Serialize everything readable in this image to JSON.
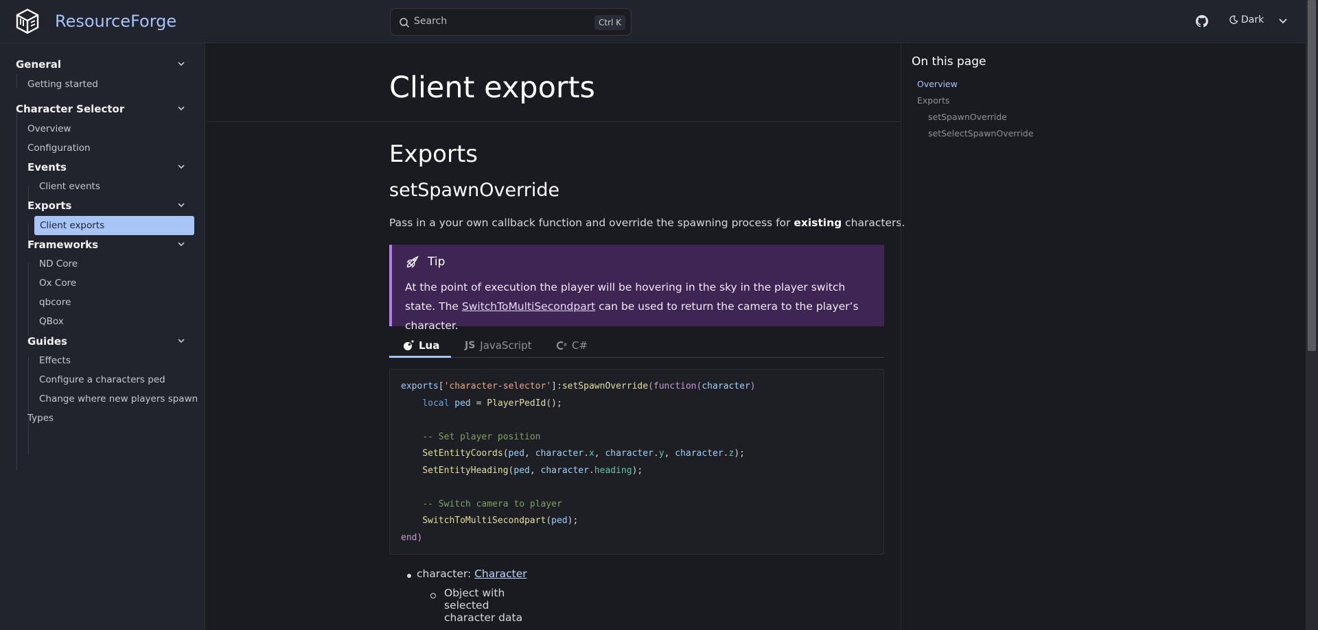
{
  "header": {
    "brand": "ResourceForge",
    "search_placeholder": "Search",
    "search_shortcut": "Ctrl K",
    "theme_label": "Dark"
  },
  "sidebar": {
    "general": {
      "title": "General",
      "items": [
        "Getting started"
      ]
    },
    "character_selector": {
      "title": "Character Selector",
      "items": [
        "Overview",
        "Configuration"
      ],
      "events": {
        "title": "Events",
        "items": [
          "Client events"
        ]
      },
      "exports": {
        "title": "Exports",
        "items": [
          "Client exports"
        ]
      },
      "frameworks": {
        "title": "Frameworks",
        "items": [
          "ND Core",
          "Ox Core",
          "qbcore",
          "QBox"
        ]
      },
      "guides": {
        "title": "Guides",
        "items": [
          "Effects",
          "Configure a characters ped",
          "Change where new players spawn"
        ]
      },
      "types": "Types"
    }
  },
  "main": {
    "title": "Client exports",
    "section": "Exports",
    "subsection": "setSpawnOverride",
    "description_pre": "Pass in a your own callback function and override the spawning process for ",
    "description_bold": "existing",
    "description_post": " characters.",
    "tip": {
      "title": "Tip",
      "text_pre": "At the point of execution the player will be hovering in the sky in the player switch state. The ",
      "link": "SwitchToMultiSecondpart",
      "text_post": " can be used to return the camera to the player’s character."
    },
    "tabs": [
      "Lua",
      "JavaScript",
      "C#"
    ],
    "code_lines": [
      "exports['character-selector']:setSpawnOverride(function(character)",
      "    local ped = PlayerPedId();",
      "",
      "    -- Set player position",
      "    SetEntityCoords(ped, character.x, character.y, character.z);",
      "    SetEntityHeading(ped, character.heading);",
      "",
      "    -- Switch camera to player",
      "    SwitchToMultiSecondpart(ped);",
      "end)"
    ],
    "params": {
      "name": "character: ",
      "type_link": "Character",
      "desc": "Object with selected character data"
    }
  },
  "toc": {
    "title": "On this page",
    "items": [
      "Overview",
      "Exports",
      "setSpawnOverride",
      "setSelectSpawnOverride"
    ]
  },
  "colors": {
    "accent": "#a9c5f8",
    "tip_bg": "#3f2554",
    "tip_border": "#b679f0"
  }
}
